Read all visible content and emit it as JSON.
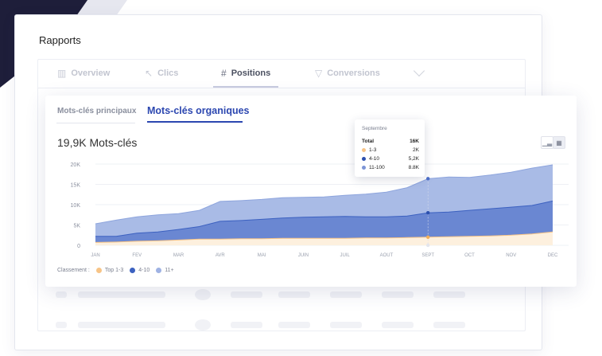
{
  "report": {
    "title": "Rapports",
    "tabs": [
      {
        "label": "Overview",
        "icon": "bar-chart-icon"
      },
      {
        "label": "Clics",
        "icon": "cursor-icon"
      },
      {
        "label": "Positions",
        "icon": "hash-icon",
        "active": true
      },
      {
        "label": "Conversions",
        "icon": "filter-icon"
      }
    ]
  },
  "keywords_card": {
    "subtabs": [
      "Mots-clés principaux",
      "Mots-clés organiques"
    ],
    "active_subtab": "Mots-clés organiques",
    "count_label": "19,9K Mots-clés",
    "legend_title": "Classement :",
    "legend": [
      {
        "label": "Top 1-3",
        "color": "#f7c487"
      },
      {
        "label": "4-10",
        "color": "#3c61c0"
      },
      {
        "label": "11+",
        "color": "#9fb2e3"
      }
    ]
  },
  "tooltip": {
    "title": "Septembre",
    "total_label": "Total",
    "total_value": "16K",
    "rows": [
      {
        "label": "1-3",
        "value": "2K",
        "color": "#f7c487"
      },
      {
        "label": "4-10",
        "value": "5,2K",
        "color": "#2b4fae"
      },
      {
        "label": "11-100",
        "value": "8.8K",
        "color": "#7d95d6"
      }
    ]
  },
  "chart_data": {
    "type": "area",
    "stacked": true,
    "x": [
      "JAN",
      "",
      "FEV",
      "",
      "MAR",
      "",
      "AVR",
      "",
      "MAI",
      "",
      "JUIN",
      "",
      "JUIL",
      "",
      "AOUT",
      "",
      "SEPT",
      "",
      "OCT",
      "",
      "NOV",
      "",
      "DEC"
    ],
    "x_tick_labels": [
      "JAN",
      "FEV",
      "MAR",
      "AVR",
      "MAI",
      "JUIN",
      "JUIL",
      "AOUT",
      "SEPT",
      "OCT",
      "NOV",
      "DEC"
    ],
    "y_ticks": [
      "0",
      "5K",
      "10K",
      "15K",
      "20K"
    ],
    "ylim": [
      0,
      20000
    ],
    "grid": true,
    "highlight_x": "SEPT",
    "series": [
      {
        "name": "Top 1-3",
        "color": "#fdf0de",
        "line": "#f7c487",
        "values": [
          700,
          800,
          1000,
          1100,
          1300,
          1500,
          1500,
          1600,
          1600,
          1700,
          1700,
          1700,
          1700,
          1800,
          1800,
          1900,
          2000,
          2100,
          2200,
          2300,
          2500,
          2800,
          3300
        ]
      },
      {
        "name": "4-10",
        "color": "#6a87d2",
        "line": "#3c61c0",
        "values": [
          1500,
          1400,
          2000,
          2200,
          2600,
          3100,
          4400,
          4500,
          4800,
          5000,
          5200,
          5300,
          5400,
          5200,
          5200,
          5300,
          6000,
          6100,
          6400,
          6700,
          6900,
          7000,
          7600
        ]
      },
      {
        "name": "11+",
        "color": "#a9bbe6",
        "line": "#8ea5dd",
        "values": [
          3100,
          4000,
          4000,
          4200,
          3900,
          4000,
          4900,
          4900,
          4900,
          5000,
          4900,
          4900,
          5200,
          5600,
          6100,
          7000,
          8400,
          8600,
          8100,
          8300,
          8600,
          9200,
          8900
        ]
      }
    ]
  }
}
